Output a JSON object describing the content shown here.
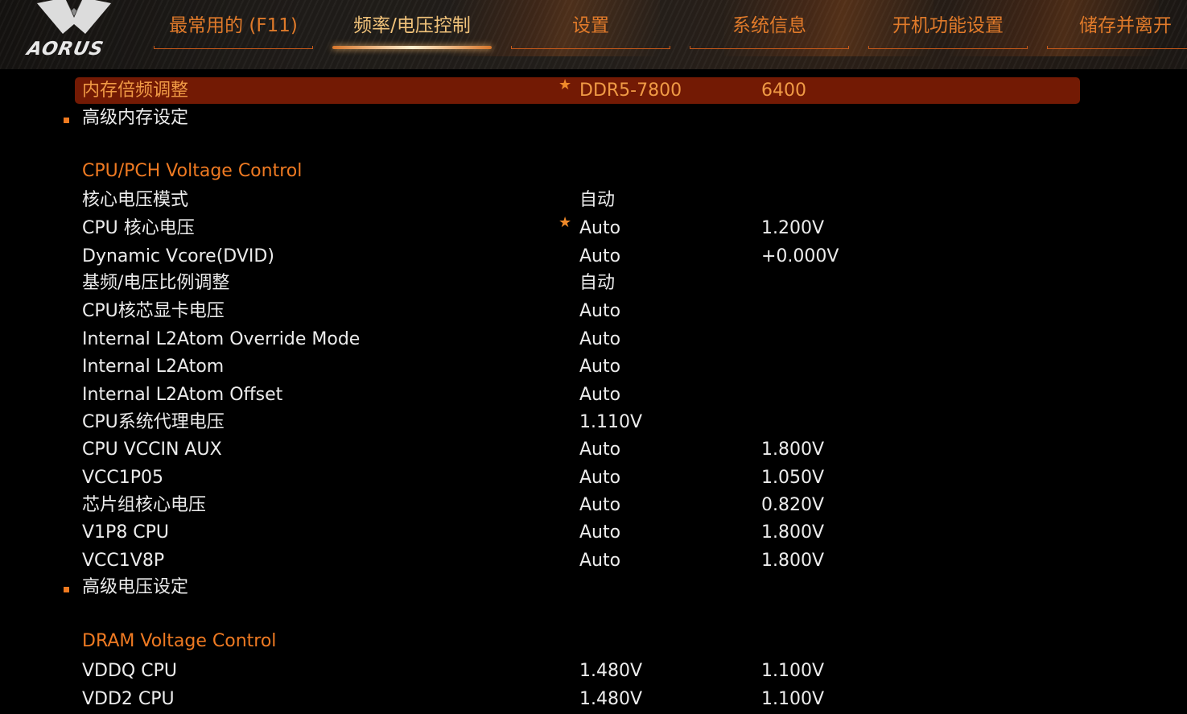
{
  "brand": {
    "logo_text": "AORUS"
  },
  "tabs": [
    {
      "label": "最常用的 (F11)",
      "active": false
    },
    {
      "label": "频率/电压控制",
      "active": true
    },
    {
      "label": "设置",
      "active": false
    },
    {
      "label": "系统信息",
      "active": false
    },
    {
      "label": "开机功能设置",
      "active": false
    },
    {
      "label": "储存并离开",
      "active": false
    }
  ],
  "rows": [
    {
      "label": "内存倍频调整",
      "value": "DDR5-7800",
      "value2": "6400",
      "star": true,
      "selected": true
    },
    {
      "label": "高级内存设定",
      "value": "",
      "value2": "",
      "bullet": true
    },
    {
      "label": "核心电压模式",
      "value": "自动",
      "value2": ""
    },
    {
      "label": "CPU 核心电压",
      "value": "Auto",
      "value2": "1.200V",
      "star": true
    },
    {
      "label": "Dynamic Vcore(DVID)",
      "value": "Auto",
      "value2": "+0.000V"
    },
    {
      "label": "基频/电压比例调整",
      "value": "自动",
      "value2": ""
    },
    {
      "label": "CPU核芯显卡电压",
      "value": "Auto",
      "value2": ""
    },
    {
      "label": "Internal L2Atom Override Mode",
      "value": "Auto",
      "value2": ""
    },
    {
      "label": "Internal L2Atom",
      "value": "Auto",
      "value2": ""
    },
    {
      "label": "Internal L2Atom Offset",
      "value": "Auto",
      "value2": ""
    },
    {
      "label": "CPU系统代理电压",
      "value": "1.110V",
      "value2": ""
    },
    {
      "label": "CPU VCCIN AUX",
      "value": "Auto",
      "value2": "1.800V"
    },
    {
      "label": "VCC1P05",
      "value": "Auto",
      "value2": "1.050V"
    },
    {
      "label": "芯片组核心电压",
      "value": "Auto",
      "value2": "0.820V"
    },
    {
      "label": "V1P8 CPU",
      "value": "Auto",
      "value2": "1.800V"
    },
    {
      "label": "VCC1V8P",
      "value": "Auto",
      "value2": "1.800V"
    },
    {
      "label": "高级电压设定",
      "value": "",
      "value2": "",
      "bullet": true
    },
    {
      "label": "VDDQ CPU",
      "value": "1.480V",
      "value2": "1.100V"
    },
    {
      "label": "VDD2 CPU",
      "value": "1.480V",
      "value2": "1.100V"
    }
  ],
  "sections": {
    "cpu_pch": "CPU/PCH Voltage Control",
    "dram": "DRAM Voltage Control"
  },
  "colors": {
    "accent": "#ef7a22",
    "highlight": "#731a04",
    "text": "#ececec"
  }
}
